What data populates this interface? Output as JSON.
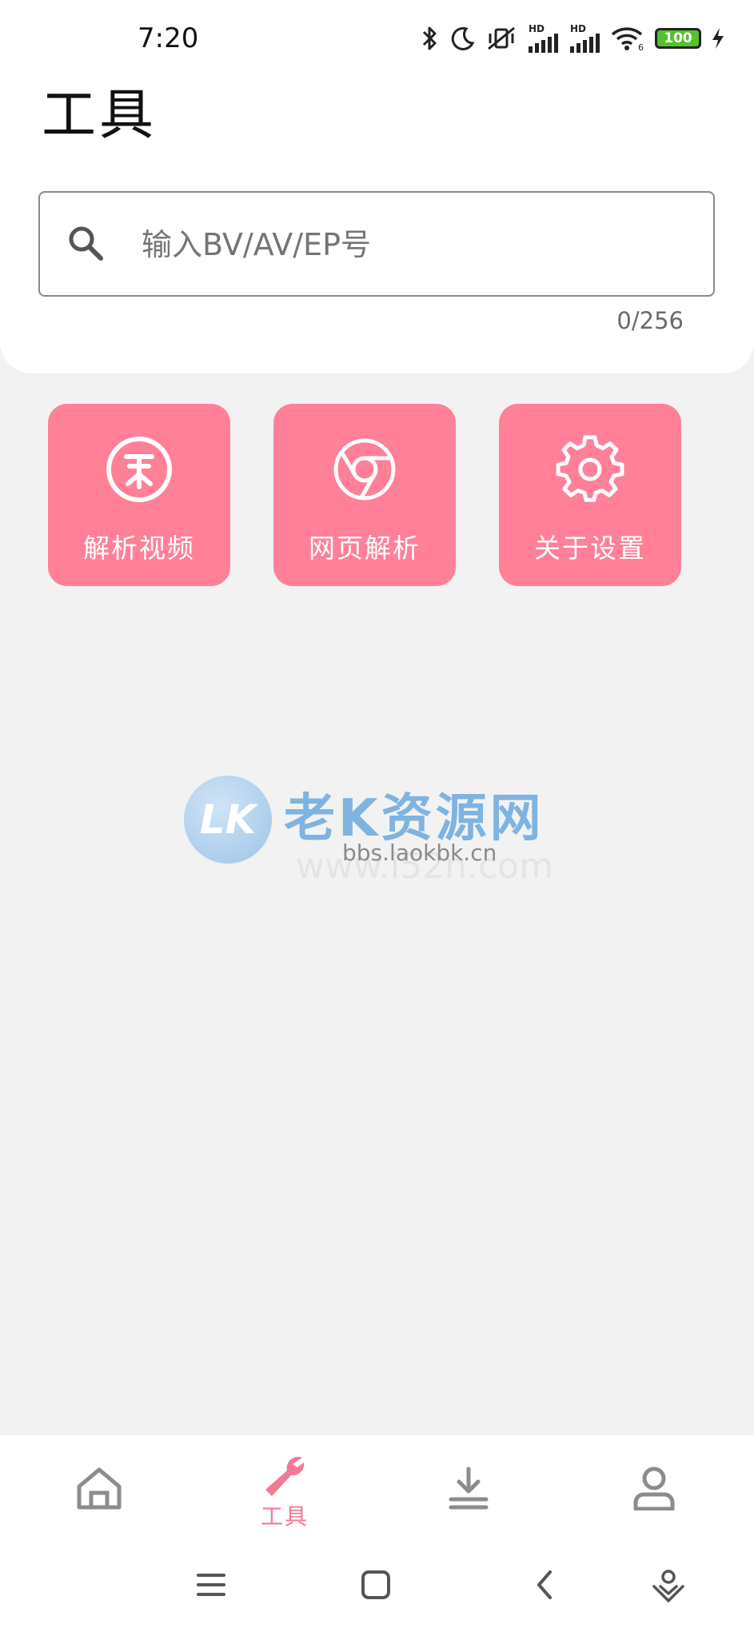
{
  "status_bar": {
    "time": "7:20",
    "battery": "100",
    "hd1": "HD",
    "hd2": "HD",
    "wifi_sub": "6"
  },
  "header": {
    "title": "工具"
  },
  "search": {
    "placeholder": "输入BV/AV/EP号",
    "value": "",
    "counter": "0/256"
  },
  "tools": [
    {
      "label": "解析视频",
      "icon": "coin-icon"
    },
    {
      "label": "网页解析",
      "icon": "chrome-icon"
    },
    {
      "label": "关于设置",
      "icon": "gear-icon"
    }
  ],
  "watermark": {
    "logo": "LK",
    "title": "老K资源网",
    "url": "bbs.laokbk.cn",
    "faint": "www.i52n.com"
  },
  "bottom_nav": {
    "items": [
      {
        "label": "",
        "icon": "home-icon",
        "active": false
      },
      {
        "label": "工具",
        "icon": "wrench-icon",
        "active": true
      },
      {
        "label": "",
        "icon": "download-icon",
        "active": false
      },
      {
        "label": "",
        "icon": "user-icon",
        "active": false
      }
    ]
  },
  "colors": {
    "accent": "#ff8097",
    "active_nav": "#f27a93",
    "inactive_nav": "#8c8c8c",
    "background": "#f2f2f2"
  }
}
